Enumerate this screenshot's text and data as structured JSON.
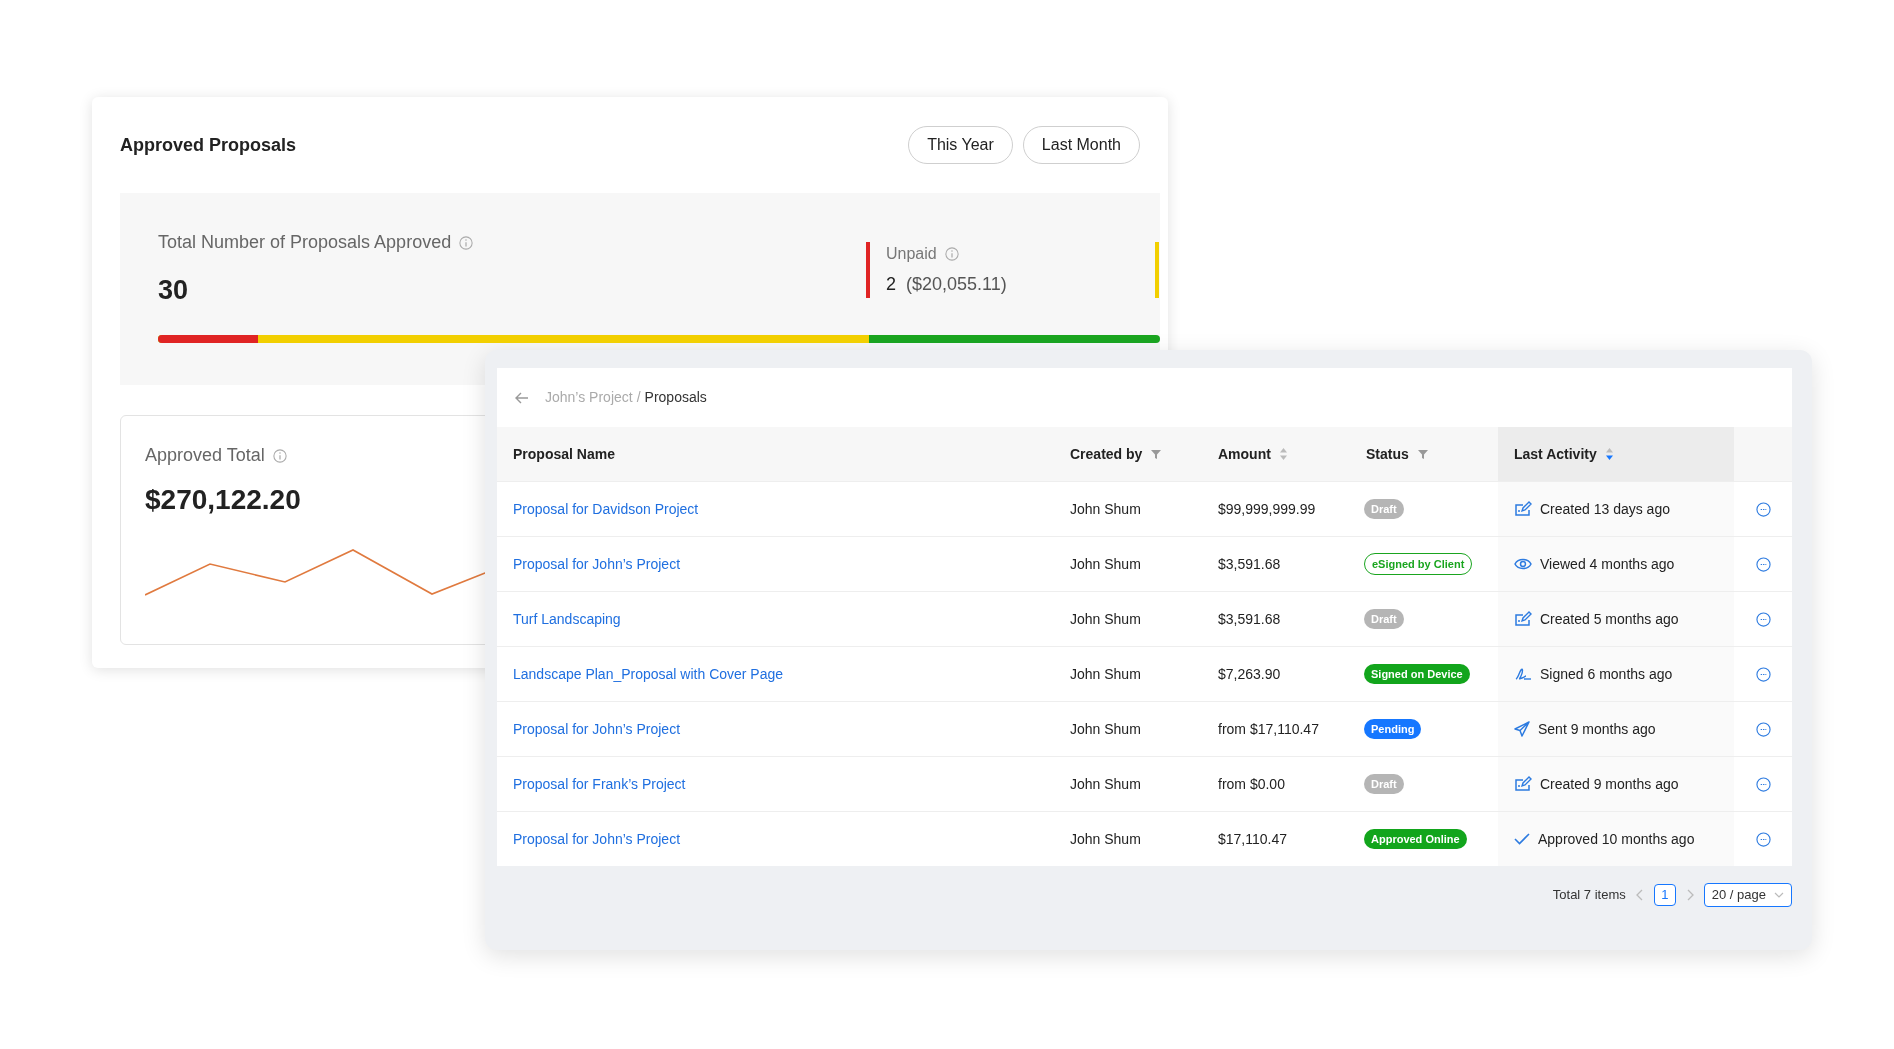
{
  "summary_card": {
    "title": "Approved Proposals",
    "periods": [
      {
        "label": "This Year",
        "selected": false
      },
      {
        "label": "Last Month",
        "selected": false
      }
    ],
    "total": {
      "label": "Total Number of Proposals Approved",
      "value": "30"
    },
    "unpaid": {
      "label": "Unpaid",
      "value": "2",
      "amount": "($20,055.11)"
    },
    "progress": {
      "color": "#1aa51f",
      "segments": [
        {
          "color": "#e02424",
          "level": 0.1
        },
        {
          "color": "#f2cf00",
          "level": 0.71
        }
      ]
    },
    "approved_total": {
      "label": "Approved Total",
      "value": "$270,122.20"
    }
  },
  "proposals": {
    "breadcrumb": {
      "parent": "John’s Project",
      "separator": "/",
      "current": "Proposals"
    },
    "columns": [
      {
        "label": "Proposal Name",
        "kind": "plain"
      },
      {
        "label": "Created by",
        "kind": "filter"
      },
      {
        "label": "Amount",
        "kind": "sort",
        "sorted": false
      },
      {
        "label": "Status",
        "kind": "filter"
      },
      {
        "label": "Last Activity",
        "kind": "sort",
        "sorted": true
      }
    ],
    "rows": [
      {
        "name": "Proposal for Davidson Project",
        "created_by": "John Shum",
        "amount": "$99,999,999.99",
        "status": {
          "label": "Draft",
          "kind": "draft"
        },
        "activity": {
          "label": "Created 13 days ago",
          "kind": "created"
        }
      },
      {
        "name": "Proposal for John’s Project",
        "created_by": "John Shum",
        "amount": "$3,591.68",
        "status": {
          "label": "eSigned by Client",
          "kind": "esigned"
        },
        "activity": {
          "label": "Viewed 4 months ago",
          "kind": "viewed"
        }
      },
      {
        "name": "Turf Landscaping",
        "created_by": "John Shum",
        "amount": "$3,591.68",
        "status": {
          "label": "Draft",
          "kind": "draft"
        },
        "activity": {
          "label": "Created 5 months ago",
          "kind": "created"
        }
      },
      {
        "name": "Landscape Plan_Proposal with Cover Page",
        "created_by": "John Shum",
        "amount": "$7,263.90",
        "status": {
          "label": "Signed on Device",
          "kind": "signed"
        },
        "activity": {
          "label": "Signed 6 months ago",
          "kind": "signed"
        }
      },
      {
        "name": "Proposal for John’s Project",
        "created_by": "John Shum",
        "amount": "from $17,110.47",
        "status": {
          "label": "Pending",
          "kind": "pending"
        },
        "activity": {
          "label": "Sent 9 months ago",
          "kind": "sent"
        }
      },
      {
        "name": "Proposal for Frank’s Project",
        "created_by": "John Shum",
        "amount": "from $0.00",
        "status": {
          "label": "Draft",
          "kind": "draft"
        },
        "activity": {
          "label": "Created 9 months ago",
          "kind": "created"
        }
      },
      {
        "name": "Proposal for John’s Project",
        "created_by": "John Shum",
        "amount": "$17,110.47",
        "status": {
          "label": "Approved Online",
          "kind": "approved"
        },
        "activity": {
          "label": "Approved 10 months ago",
          "kind": "approved"
        }
      }
    ],
    "pagination": {
      "total": "Total 7 items",
      "pages": [
        {
          "label": "1",
          "selected": true
        }
      ],
      "page_size": "20 / page"
    }
  }
}
